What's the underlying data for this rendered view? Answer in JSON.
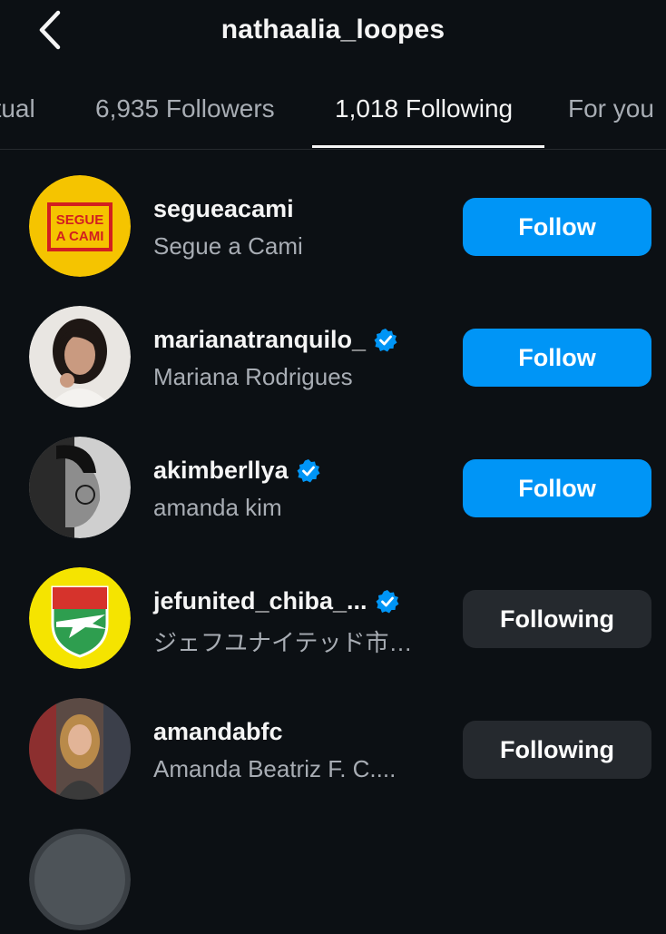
{
  "header": {
    "title": "nathaalia_loopes",
    "back_icon": "chevron-left-icon"
  },
  "tabs": [
    {
      "label": "Mutual",
      "display": "utual",
      "active": false
    },
    {
      "label": "6,935 Followers",
      "active": false
    },
    {
      "label": "1,018 Following",
      "active": true
    },
    {
      "label": "For you",
      "active": false
    }
  ],
  "accounts": [
    {
      "username": "segueacami",
      "full_name": "Segue a Cami",
      "verified": false,
      "button": "Follow",
      "avatar_text": "SEGUE A CAMI"
    },
    {
      "username": "marianatranquilo_",
      "full_name": "Mariana Rodrigues",
      "verified": true,
      "button": "Follow"
    },
    {
      "username": "akimberllya",
      "full_name": "amanda kim",
      "verified": true,
      "button": "Follow"
    },
    {
      "username": "jefunited_chiba_...",
      "full_name": "ジェフユナイテッド市…",
      "verified": true,
      "button": "Following"
    },
    {
      "username": "amandabfc",
      "full_name": "Amanda Beatriz F. C....",
      "verified": false,
      "button": "Following"
    }
  ],
  "colors": {
    "background": "#0c1014",
    "follow_button": "#0095f6",
    "following_button": "#25292e",
    "verified": "#0095f6"
  }
}
